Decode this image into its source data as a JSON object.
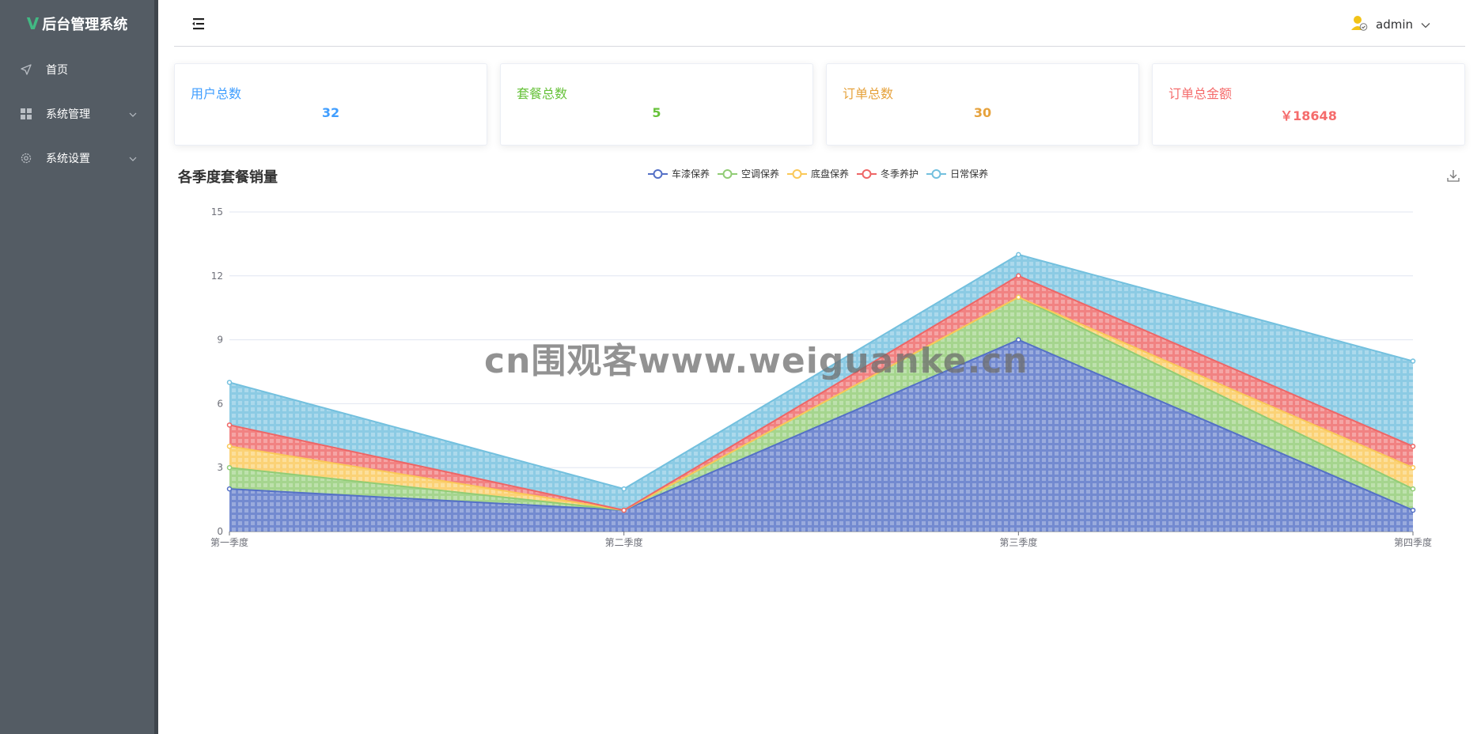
{
  "app": {
    "title": "后台管理系统",
    "logo_glyph": "V"
  },
  "sidebar": {
    "items": [
      {
        "label": "首页",
        "icon": "navigation-icon"
      },
      {
        "label": "系统管理",
        "icon": "grid-icon"
      },
      {
        "label": "系统设置",
        "icon": "gear-icon"
      }
    ]
  },
  "header": {
    "username": "admin"
  },
  "stats": [
    {
      "label": "用户总数",
      "value": "32",
      "color": "#409EFF"
    },
    {
      "label": "套餐总数",
      "value": "5",
      "color": "#67C23A"
    },
    {
      "label": "订单总数",
      "value": "30",
      "color": "#E6A23C"
    },
    {
      "label": "订单总金额",
      "value": "￥18648",
      "color": "#F56C6C"
    }
  ],
  "watermark": "cn围观客www.weiguanke.cn",
  "chart_data": {
    "type": "area",
    "stacked": true,
    "title": "各季度套餐销量",
    "categories": [
      "第一季度",
      "第二季度",
      "第三季度",
      "第四季度"
    ],
    "ylim": [
      0,
      15
    ],
    "yticks": [
      0,
      3,
      6,
      9,
      12,
      15
    ],
    "grid": true,
    "legend_position": "top-center",
    "series": [
      {
        "name": "车漆保养",
        "values": [
          2,
          1,
          9,
          1
        ],
        "color": "#5470c6"
      },
      {
        "name": "空调保养",
        "values": [
          1,
          0,
          2,
          1
        ],
        "color": "#91cc75"
      },
      {
        "name": "底盘保养",
        "values": [
          1,
          0,
          0,
          1
        ],
        "color": "#fac858"
      },
      {
        "name": "冬季养护",
        "values": [
          1,
          0,
          1,
          1
        ],
        "color": "#ee6666"
      },
      {
        "name": "日常保养",
        "values": [
          2,
          1,
          1,
          4
        ],
        "color": "#73c0de"
      }
    ]
  }
}
